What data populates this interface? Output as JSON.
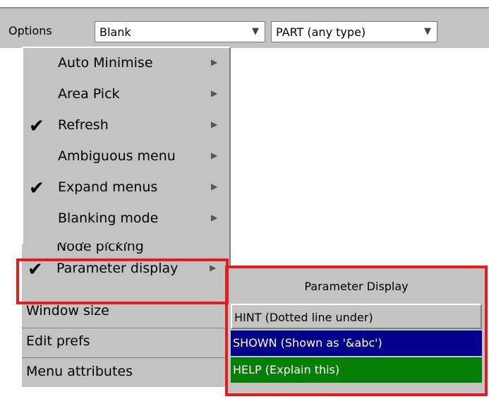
{
  "toolbar": {
    "options_label": "Options",
    "blank_value": "Blank",
    "part_value": "PART  (any type)",
    "dropdown_arrow": "▼"
  },
  "menu": {
    "items": [
      {
        "label": "Auto Minimise",
        "checked": false
      },
      {
        "label": "Area Pick",
        "checked": false
      },
      {
        "label": "Refresh",
        "checked": true
      },
      {
        "label": "Ambiguous menu",
        "checked": false
      },
      {
        "label": "Expand menus",
        "checked": true
      },
      {
        "label": "Blanking mode",
        "checked": false
      },
      {
        "label": "Node picking",
        "checked": false
      },
      {
        "label": "Parameter display",
        "checked": true
      }
    ],
    "check_glyph": "✔",
    "submenu_glyph": "▶"
  },
  "bottom_items": [
    {
      "label": "Window size"
    },
    {
      "label": "Edit prefs"
    },
    {
      "label": "Menu attributes"
    }
  ],
  "parameter_display": {
    "title": "Parameter Display",
    "options": [
      {
        "label": "HINT  (Dotted line under)",
        "color": "#c3c3c3"
      },
      {
        "label": "SHOWN (Shown as '&abc')",
        "color": "#000088"
      },
      {
        "label": "HELP  (Explain this)",
        "color": "#067f06"
      }
    ]
  },
  "colors": {
    "panel_bg": "#c3c3c3",
    "highlight": "#e01e1e",
    "shown_bg": "#000088",
    "help_bg": "#067f06"
  }
}
